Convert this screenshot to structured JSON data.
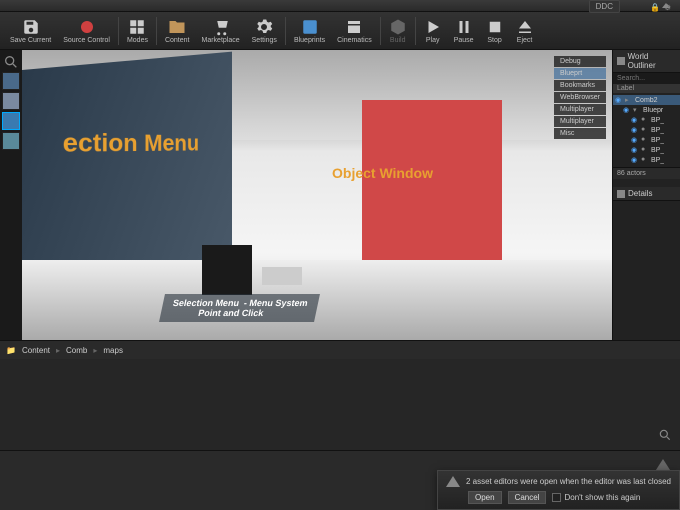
{
  "topbar": {
    "ddc": "DDC"
  },
  "toolbar": [
    {
      "id": "save",
      "label": "Save Current"
    },
    {
      "id": "source",
      "label": "Source Control"
    },
    {
      "id": "modes",
      "label": "Modes"
    },
    {
      "id": "content",
      "label": "Content"
    },
    {
      "id": "marketplace",
      "label": "Marketplace"
    },
    {
      "id": "settings",
      "label": "Settings"
    },
    {
      "id": "blueprints",
      "label": "Blueprints"
    },
    {
      "id": "cinematics",
      "label": "Cinematics"
    },
    {
      "id": "build",
      "label": "Build"
    },
    {
      "id": "play",
      "label": "Play"
    },
    {
      "id": "pause",
      "label": "Pause"
    },
    {
      "id": "stop",
      "label": "Stop"
    },
    {
      "id": "eject",
      "label": "Eject"
    }
  ],
  "viewport": {
    "text3d_1": "ection Menu",
    "text3d_2": "Object Window",
    "caption": "Selection Menu  - Menu System\n           Point and Click",
    "tabs": [
      "Debug",
      "Blueprt",
      "Bookmarks",
      "WebBrowser",
      "Multiplayer",
      "Multiplayer",
      "Misc"
    ]
  },
  "outliner": {
    "title": "World Outliner",
    "search": "Search...",
    "col": "Label",
    "root": "Comb2",
    "folder": "Bluepr",
    "items": [
      "BP_",
      "BP_",
      "BP_",
      "BP_",
      "BP_"
    ],
    "count": "86 actors"
  },
  "details": {
    "title": "Details"
  },
  "content_browser": {
    "crumbs": [
      "Content",
      "Comb",
      "maps"
    ]
  },
  "toast": {
    "message": "2 asset editors were open when the editor was last closed",
    "open": "Open",
    "cancel": "Cancel",
    "dont_show": "Don't show this again"
  }
}
